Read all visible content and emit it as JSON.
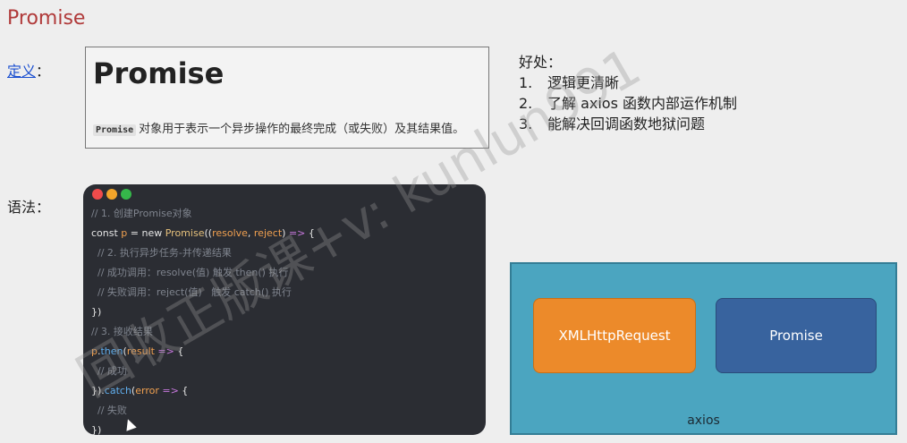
{
  "page": {
    "title": "Promise"
  },
  "definition": {
    "label": "定义",
    "colon": "：",
    "heading": "Promise",
    "code_term": "Promise",
    "description": "对象用于表示一个异步操作的最终完成（或失败）及其结果值。"
  },
  "benefits": {
    "title": "好处：",
    "items": [
      {
        "num": "1.",
        "text": "逻辑更清晰"
      },
      {
        "num": "2.",
        "text": "了解 axios 函数内部运作机制"
      },
      {
        "num": "3.",
        "text": "能解决回调函数地狱问题"
      }
    ]
  },
  "syntax": {
    "label": "语法：",
    "dot_colors": [
      "#ef4b4b",
      "#f2a42a",
      "#35b84a"
    ],
    "code_lines": [
      [
        {
          "t": "// 1. 创建Promise对象",
          "c": "c-cmt"
        }
      ],
      [
        {
          "t": "const ",
          "c": "c-kw"
        },
        {
          "t": "p",
          "c": "c-var"
        },
        {
          "t": " = ",
          "c": "c-plain"
        },
        {
          "t": "new ",
          "c": "c-kw"
        },
        {
          "t": "Promise",
          "c": "c-ctor"
        },
        {
          "t": "((",
          "c": "c-plain"
        },
        {
          "t": "resolve",
          "c": "c-var"
        },
        {
          "t": ", ",
          "c": "c-plain"
        },
        {
          "t": "reject",
          "c": "c-var"
        },
        {
          "t": ") ",
          "c": "c-plain"
        },
        {
          "t": "=>",
          "c": "c-op"
        },
        {
          "t": " {",
          "c": "c-plain"
        }
      ],
      [
        {
          "t": "  // 2. 执行异步任务-并传递结果",
          "c": "c-cmt"
        }
      ],
      [
        {
          "t": "  // 成功调用：resolve(值) 触发 then() 执行",
          "c": "c-cmt"
        }
      ],
      [
        {
          "t": "  // 失败调用：reject(值)   触发 catch() 执行",
          "c": "c-cmt"
        }
      ],
      [
        {
          "t": "})",
          "c": "c-plain"
        }
      ],
      [
        {
          "t": "// 3. 接收结果",
          "c": "c-cmt"
        }
      ],
      [
        {
          "t": "p",
          "c": "c-var"
        },
        {
          "t": ".",
          "c": "c-plain"
        },
        {
          "t": "then",
          "c": "c-fn"
        },
        {
          "t": "(",
          "c": "c-plain"
        },
        {
          "t": "result",
          "c": "c-var"
        },
        {
          "t": " => ",
          "c": "c-op"
        },
        {
          "t": "{",
          "c": "c-plain"
        }
      ],
      [
        {
          "t": "  // 成功",
          "c": "c-cmt"
        }
      ],
      [
        {
          "t": "}).",
          "c": "c-plain"
        },
        {
          "t": "catch",
          "c": "c-fn"
        },
        {
          "t": "(",
          "c": "c-plain"
        },
        {
          "t": "error",
          "c": "c-var"
        },
        {
          "t": " => ",
          "c": "c-op"
        },
        {
          "t": "{",
          "c": "c-plain"
        }
      ],
      [
        {
          "t": "  // 失败",
          "c": "c-cmt"
        }
      ],
      [
        {
          "t": "})",
          "c": "c-plain"
        }
      ]
    ]
  },
  "diagram": {
    "xhr_label": "XMLHttpRequest",
    "promise_label": "Promise",
    "container_label": "axios"
  },
  "watermark": {
    "text": "回收正版课+v: kunlun991"
  }
}
